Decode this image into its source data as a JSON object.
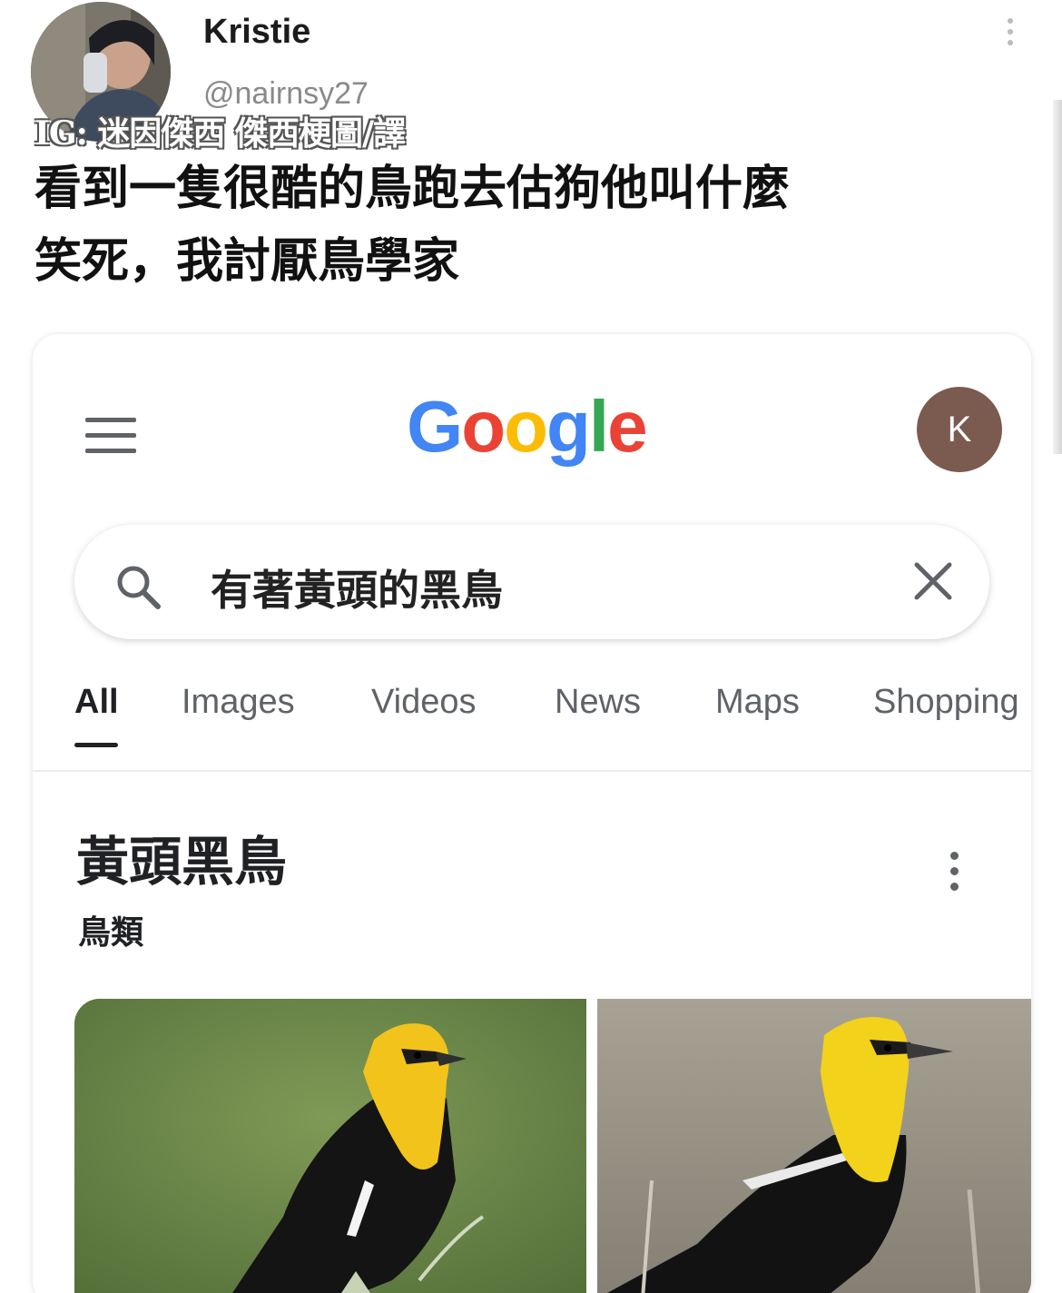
{
  "tweet": {
    "author_name": "Kristie",
    "author_handle": "@nairnsy27",
    "watermark": "IG: 迷因傑西 傑西梗圖/譯",
    "text_lines": [
      "看到一隻很酷的鳥跑去估狗他叫什麼",
      "笑死，我討厭鳥學家"
    ]
  },
  "google": {
    "logo_text": "Google",
    "account_initial": "K",
    "search": {
      "query": "有著黃頭的黑鳥"
    },
    "tabs": [
      {
        "label": "All",
        "active": true
      },
      {
        "label": "Images",
        "active": false
      },
      {
        "label": "Videos",
        "active": false
      },
      {
        "label": "News",
        "active": false
      },
      {
        "label": "Maps",
        "active": false
      },
      {
        "label": "Shopping",
        "active": false
      }
    ],
    "knowledge_panel": {
      "title": "黃頭黑鳥",
      "subtitle": "鳥類"
    }
  },
  "colors": {
    "google_blue": "#4285f4",
    "google_red": "#ea4335",
    "google_yellow": "#fbbc05",
    "google_green": "#34a853",
    "account_bg": "#7b5a50",
    "bird_yellow": "#f2c31a"
  },
  "icons": [
    "more-vert-icon",
    "menu-icon",
    "search-icon",
    "close-icon"
  ]
}
